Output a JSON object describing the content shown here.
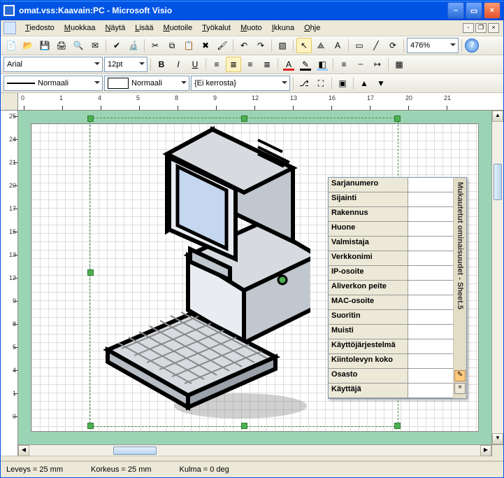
{
  "title": "omat.vss:Kaavain:PC - Microsoft Visio",
  "menu": [
    "Tiedosto",
    "Muokkaa",
    "Näytä",
    "Lisää",
    "Muotoile",
    "Työkalut",
    "Muoto",
    "Ikkuna",
    "Ohje"
  ],
  "font": {
    "name": "Arial",
    "size": "12pt"
  },
  "line_style_label": "Normaali",
  "fill_style_label": "Normaali",
  "layer_label": "{Ei kerrosta}",
  "zoom": "476%",
  "statusbar": {
    "width": "Leveys = 25 mm",
    "height": "Korkeus = 25 mm",
    "angle": "Kulma = 0 deg"
  },
  "ruler_ticks_v": [
    "25",
    "24",
    "21",
    "20",
    "17",
    "16",
    "13",
    "12",
    "9",
    "8",
    "5",
    "4",
    "1",
    "0"
  ],
  "ruler_ticks_h": [
    "0",
    "1",
    "4",
    "5",
    "8",
    "9",
    "12",
    "13",
    "16",
    "17",
    "20",
    "21"
  ],
  "properties": {
    "panel_title": "Mukautetut ominaisuudet - Sheet.5",
    "rows": [
      {
        "label": "Sarjanumero",
        "value": ""
      },
      {
        "label": "Sijainti",
        "value": ""
      },
      {
        "label": "Rakennus",
        "value": ""
      },
      {
        "label": "Huone",
        "value": ""
      },
      {
        "label": "Valmistaja",
        "value": ""
      },
      {
        "label": "Verkkonimi",
        "value": ""
      },
      {
        "label": "IP-osoite",
        "value": ""
      },
      {
        "label": "Aliverkon peite",
        "value": ""
      },
      {
        "label": "MAC-osoite",
        "value": ""
      },
      {
        "label": "Suoritin",
        "value": ""
      },
      {
        "label": "Muisti",
        "value": ""
      },
      {
        "label": "Käyttöjärjestelmä",
        "value": ""
      },
      {
        "label": "Kiintolevyn koko",
        "value": ""
      },
      {
        "label": "Osasto",
        "value": ""
      },
      {
        "label": "Käyttäjä",
        "value": ""
      }
    ]
  },
  "close_glyph": "×",
  "help_glyph": "?",
  "pencil_glyph": "✎"
}
